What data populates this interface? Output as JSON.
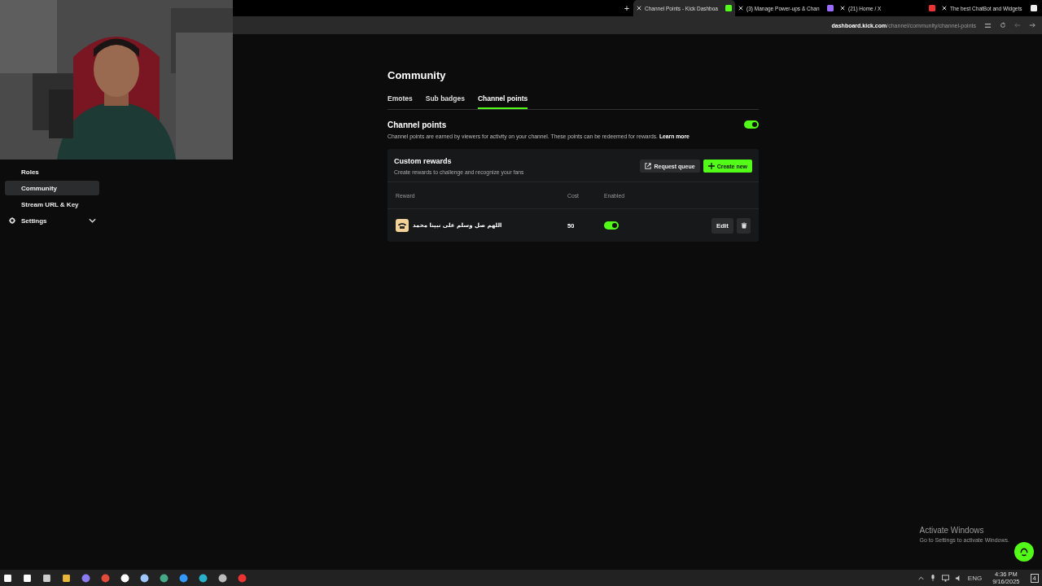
{
  "browser": {
    "new_tab": "+",
    "tabs": [
      {
        "title": "Channel Points - Kick Dashboa",
        "selected": true
      },
      {
        "title": "(3) Manage Power-ups & Chan",
        "selected": false
      },
      {
        "title": "(21) Home / X",
        "selected": false
      },
      {
        "title": "The best ChatBot and Widgets",
        "selected": false
      }
    ],
    "address": {
      "domain": "dashboard.kick.com",
      "path": "/channel/community/channel-points"
    }
  },
  "sidebar": {
    "items": [
      {
        "label": "Roles",
        "kind": "link",
        "selected": false
      },
      {
        "label": "Community",
        "kind": "link",
        "selected": true
      },
      {
        "label": "Stream URL & Key",
        "kind": "link",
        "selected": false
      },
      {
        "label": "Settings",
        "kind": "group",
        "selected": false
      }
    ]
  },
  "page": {
    "title": "Community",
    "tabs": [
      {
        "label": "Emotes",
        "selected": false
      },
      {
        "label": "Sub badges",
        "selected": false
      },
      {
        "label": "Channel points",
        "selected": true
      }
    ],
    "channel_points": {
      "title": "Channel points",
      "enabled": true,
      "description": "Channel points are earned by viewers for activity on your channel. These points can be redeemed for rewards.",
      "learn_more": "Learn more"
    },
    "custom_rewards": {
      "title": "Custom rewards",
      "subtitle": "Create rewards to challenge and recognize your fans",
      "request_queue": "Request queue",
      "create_new": "Create new",
      "columns": [
        "Reward",
        "Cost",
        "Enabled"
      ],
      "rows": [
        {
          "reward": "اللهم صل وسلم على نبينا محمد",
          "cost": "50",
          "enabled": true,
          "edit": "Edit"
        }
      ]
    }
  },
  "activation": {
    "title": "Activate Windows",
    "subtitle": "Go to Settings to activate Windows."
  },
  "taskbar": {
    "language": "ENG",
    "time": "4:36 PM",
    "date": "9/16/2025",
    "notifications": "4"
  }
}
